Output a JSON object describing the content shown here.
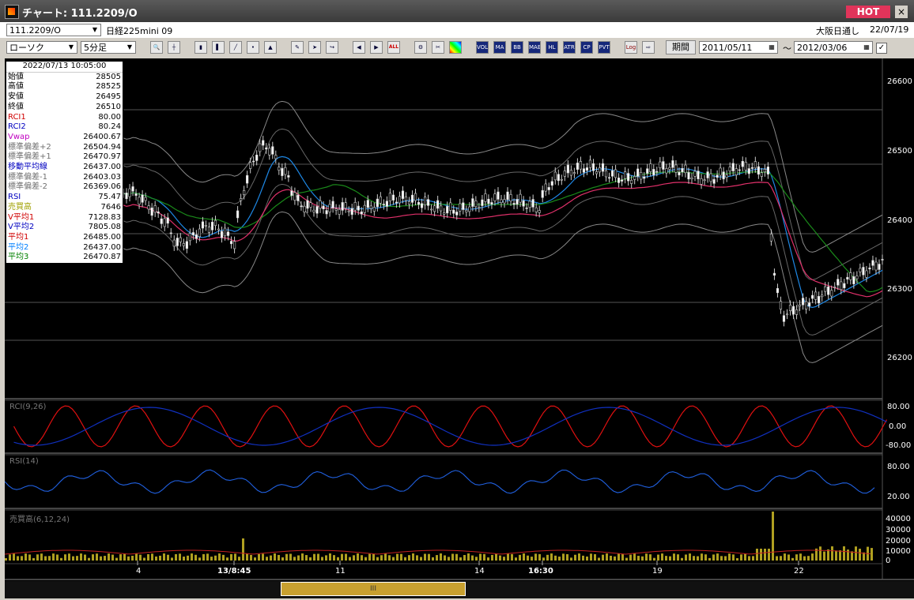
{
  "window": {
    "title": "チャート: 111.2209/O",
    "hot": "HOT",
    "close": "×"
  },
  "header": {
    "symbol": "111.2209/O",
    "name": "日経225mini 09",
    "market": "大阪日通し",
    "date": "22/07/19"
  },
  "toolbar": {
    "chart_type": "ローソク",
    "interval": "5分足",
    "buttons": [
      "VOL",
      "MA",
      "BB",
      "MAE",
      "HL",
      "ATR",
      "CP",
      "PVT"
    ],
    "log": "Log",
    "period_label": "期間",
    "from_date": "2011/05/11",
    "to_date": "2012/03/06",
    "tilde": "～",
    "all": "ALL"
  },
  "info": {
    "datetime": "2022/07/13  10:05:00",
    "rows": [
      {
        "label": "始値",
        "value": "28505",
        "color": "#000"
      },
      {
        "label": "高値",
        "value": "28525",
        "color": "#000"
      },
      {
        "label": "安値",
        "value": "26495",
        "color": "#000"
      },
      {
        "label": "終値",
        "value": "26510",
        "color": "#000"
      },
      {
        "label": "RCI1",
        "value": "80.00",
        "color": "#d00000"
      },
      {
        "label": "RCI2",
        "value": "80.24",
        "color": "#0000c0"
      },
      {
        "label": "Vwap",
        "value": "26400.67",
        "color": "#c000c0"
      },
      {
        "label": "標準偏差+2",
        "value": "26504.94",
        "color": "#707070"
      },
      {
        "label": "標準偏差+1",
        "value": "26470.97",
        "color": "#707070"
      },
      {
        "label": "移動平均線",
        "value": "26437.00",
        "color": "#0000c0"
      },
      {
        "label": "標準偏差-1",
        "value": "26403.03",
        "color": "#707070"
      },
      {
        "label": "標準偏差-2",
        "value": "26369.06",
        "color": "#707070"
      },
      {
        "label": "RSI",
        "value": "75.47",
        "color": "#0000c0"
      },
      {
        "label": "売買高",
        "value": "7646",
        "color": "#a0a000"
      },
      {
        "label": "V平均1",
        "value": "7128.83",
        "color": "#d00000"
      },
      {
        "label": "V平均2",
        "value": "7805.08",
        "color": "#0000c0"
      },
      {
        "label": "平均1",
        "value": "26485.00",
        "color": "#d00000"
      },
      {
        "label": "平均2",
        "value": "26437.00",
        "color": "#0080ff"
      },
      {
        "label": "平均3",
        "value": "26470.87",
        "color": "#008000"
      }
    ]
  },
  "price_axis": [
    "26600",
    "26500",
    "26400",
    "26300",
    "26200"
  ],
  "rci_axis": [
    "80.00",
    "0.00",
    "-80.00"
  ],
  "rsi_axis": [
    "80.00",
    "20.00"
  ],
  "vol_axis": [
    "40000",
    "30000",
    "20000",
    "10000",
    "0"
  ],
  "x_axis": [
    "4",
    "13/8:45",
    "11",
    "14",
    "16:30",
    "19",
    "22"
  ],
  "panels": {
    "rci": "RCI(9,26)",
    "rsi": "RSI(14)",
    "vol": "売買高(6,12,24)"
  },
  "scroll_grip": "III"
}
